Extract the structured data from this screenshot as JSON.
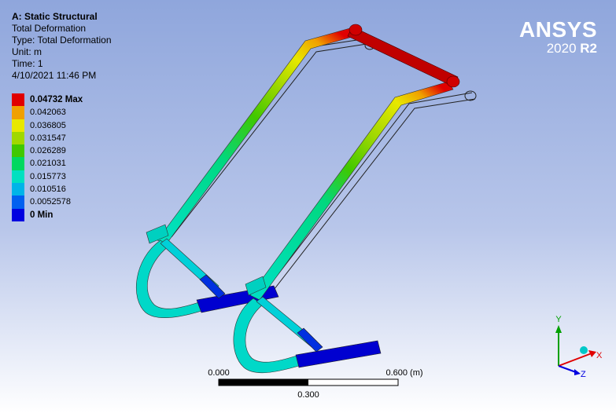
{
  "header": {
    "title": "A: Static Structural",
    "lines": [
      "Total Deformation",
      "Type: Total Deformation",
      "Unit: m",
      "Time: 1",
      "4/10/2021 11:46 PM"
    ]
  },
  "legend": {
    "entries": [
      {
        "label": "0.04732 Max",
        "color": "#e00000",
        "bold": true
      },
      {
        "label": "0.042063",
        "color": "#f0a000"
      },
      {
        "label": "0.036805",
        "color": "#e8e800"
      },
      {
        "label": "0.031547",
        "color": "#a0d800"
      },
      {
        "label": "0.026289",
        "color": "#40c800"
      },
      {
        "label": "0.021031",
        "color": "#00d860"
      },
      {
        "label": "0.015773",
        "color": "#00e0c0"
      },
      {
        "label": "0.010516",
        "color": "#00b4e8"
      },
      {
        "label": "0.0052578",
        "color": "#0060f0"
      },
      {
        "label": "0 Min",
        "color": "#0000e0",
        "bold": true
      }
    ]
  },
  "brand": {
    "name": "ANSYS",
    "version": "2020",
    "release": "R2"
  },
  "scale_bar": {
    "left_label": "0.000",
    "right_label": "0.600 (m)",
    "mid_label": "0.300"
  },
  "triad": {
    "x_label": "X",
    "y_label": "Y",
    "z_label": "Z"
  }
}
